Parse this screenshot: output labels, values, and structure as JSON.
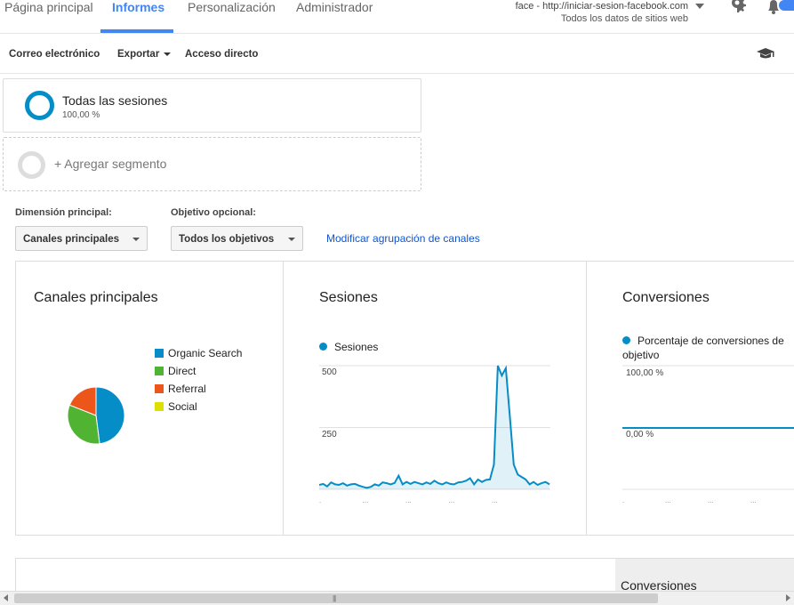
{
  "nav": {
    "tabs": [
      {
        "label": "Página principal"
      },
      {
        "label": "Informes"
      },
      {
        "label": "Personalización"
      },
      {
        "label": "Administrador"
      }
    ],
    "active_tab": "Informes",
    "account": {
      "property": "face - http://iniciar-sesion-facebook.com",
      "view": "Todos los datos de sitios web"
    },
    "icons": [
      "settings-gear-icon",
      "notifications-bell-icon"
    ]
  },
  "toolbar": {
    "email_label": "Correo electrónico",
    "export_label": "Exportar",
    "shortcut_label": "Acceso directo",
    "icon": "graduation-cap-icon"
  },
  "segments": {
    "active": {
      "name": "Todas las sesiones",
      "percent": "100,00 %"
    },
    "add_label": "+ Agregar segmento"
  },
  "controls": {
    "primary_dimension_label": "Dimensión principal:",
    "primary_dimension_value": "Canales principales",
    "optional_goal_label": "Objetivo opcional:",
    "optional_goal_value": "Todos los objetivos",
    "modify_link": "Modificar agrupación de canales"
  },
  "colors": {
    "accent": "#4285f4",
    "series": "#058dc7",
    "organic": "#058dc7",
    "direct": "#50b432",
    "referral": "#ed561b",
    "social": "#dddf00"
  },
  "charts": {
    "pie_title": "Canales principales",
    "sessions_title": "Sesiones",
    "conversions_title": "Conversiones",
    "sessions_series": "Sesiones",
    "conversions_series": "Porcentaje de conversiones de objetivo"
  },
  "chart_data": [
    {
      "type": "pie",
      "title": "Canales principales",
      "categories": [
        "Organic Search",
        "Direct",
        "Referral",
        "Social"
      ],
      "values": [
        48,
        33,
        19,
        0
      ]
    },
    {
      "type": "area",
      "title": "Sesiones",
      "series": [
        {
          "name": "Sesiones",
          "values": [
            18,
            22,
            12,
            28,
            20,
            18,
            25,
            15,
            20,
            22,
            15,
            10,
            6,
            10,
            20,
            15,
            28,
            25,
            20,
            26,
            55,
            20,
            30,
            22,
            30,
            25,
            20,
            28,
            22,
            35,
            25,
            20,
            28,
            22,
            20,
            28,
            30,
            35,
            45,
            20,
            40,
            30,
            38,
            40,
            100,
            510,
            460,
            490,
            300,
            100,
            60,
            50,
            40,
            20,
            30,
            18,
            25,
            30,
            20
          ]
        }
      ],
      "y_ticks": [
        "500",
        "250"
      ],
      "ylim": [
        0,
        500
      ]
    },
    {
      "type": "line",
      "title": "Conversiones",
      "series": [
        {
          "name": "Porcentaje de conversiones de objetivo",
          "values": [
            0,
            0,
            0,
            0,
            0,
            0,
            0,
            0,
            0,
            0
          ]
        }
      ],
      "y_ticks": [
        "100,00 %",
        "0,00 %"
      ],
      "ylim": [
        0,
        100
      ]
    }
  ],
  "bottom": {
    "conversions_header": "Conversiones"
  }
}
